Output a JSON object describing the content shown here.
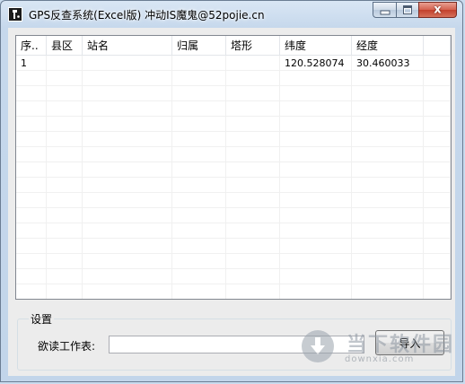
{
  "window": {
    "title": "GPS反查系统(Excel版) 冲动IS魔鬼@52pojie.cn",
    "close_glyph": "x"
  },
  "listview": {
    "columns": [
      "序..",
      "县区",
      "站名",
      "归属",
      "塔形",
      "纬度",
      "经度",
      ""
    ],
    "rows": [
      [
        "1",
        "",
        "",
        "",
        "",
        "120.528074",
        "30.460033",
        ""
      ]
    ]
  },
  "settings": {
    "group_label": "设置",
    "field_label": "欲读工作表:",
    "path_value": "",
    "import_label": "导入"
  },
  "watermark": {
    "cn_text": "当下软件园",
    "en_text": "downxia.com"
  }
}
